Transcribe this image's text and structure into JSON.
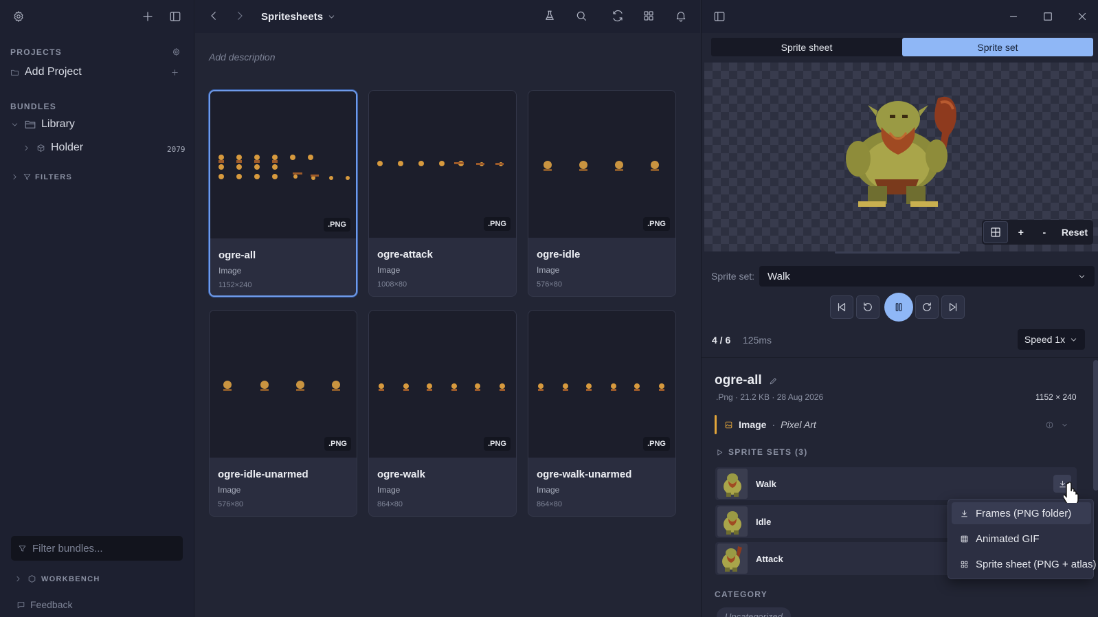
{
  "sidebar": {
    "projects_title": "PROJECTS",
    "add_project": "Add Project",
    "bundles_title": "BUNDLES",
    "library": "Library",
    "holder": "Holder",
    "holder_count": "2079",
    "filters": "FILTERS",
    "filter_placeholder": "Filter bundles...",
    "workbench": "WORKBENCH",
    "feedback": "Feedback"
  },
  "main": {
    "title": "Spritesheets",
    "description_placeholder": "Add description",
    "cards": [
      {
        "name": "ogre-all",
        "type": "Image",
        "dims": "1152×240",
        "badge": ".PNG"
      },
      {
        "name": "ogre-attack",
        "type": "Image",
        "dims": "1008×80",
        "badge": ".PNG"
      },
      {
        "name": "ogre-idle",
        "type": "Image",
        "dims": "576×80",
        "badge": ".PNG"
      },
      {
        "name": "ogre-idle-unarmed",
        "type": "Image",
        "dims": "576×80",
        "badge": ".PNG"
      },
      {
        "name": "ogre-walk",
        "type": "Image",
        "dims": "864×80",
        "badge": ".PNG"
      },
      {
        "name": "ogre-walk-unarmed",
        "type": "Image",
        "dims": "864×80",
        "badge": ".PNG"
      }
    ]
  },
  "panel": {
    "tabs": [
      "Sprite sheet",
      "Sprite set"
    ],
    "zoom_plus": "+",
    "zoom_minus": "-",
    "zoom_reset": "Reset",
    "sprite_set_label": "Sprite set:",
    "sprite_set_value": "Walk",
    "frame_counter": "4 / 6",
    "frame_time": "125ms",
    "speed": "Speed 1x",
    "asset_name": "ogre-all",
    "asset_meta": ".Png · 21.2 KB · 28 Aug 2026",
    "asset_dims": "1152 × 240",
    "asset_kind": "Image",
    "asset_sep": "·",
    "asset_style": "Pixel Art",
    "sprite_sets_title": "SPRITE SETS (3)",
    "sprite_sets": [
      "Walk",
      "Idle",
      "Attack"
    ],
    "category_title": "CATEGORY",
    "category_value": "Uncategorized"
  },
  "menu": {
    "items": [
      "Frames (PNG folder)",
      "Animated GIF",
      "Sprite sheet (PNG + atlas)"
    ]
  },
  "colors": {
    "accent": "#8fb7f6",
    "selected_border": "#6f9bea",
    "pixel_art_marker": "#e2a53a"
  }
}
